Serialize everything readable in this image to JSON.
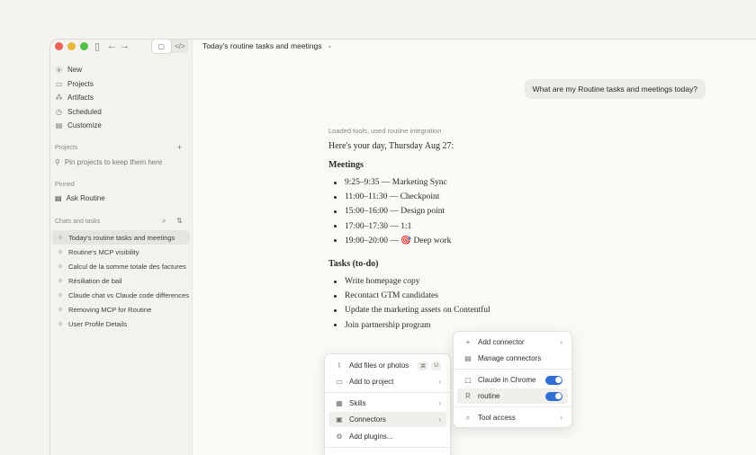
{
  "window": {
    "title": "Today's routine tasks and meetings"
  },
  "sidebar": {
    "nav": [
      {
        "label": "New",
        "icon": "plus-icon"
      },
      {
        "label": "Projects",
        "icon": "folder-icon"
      },
      {
        "label": "Artifacts",
        "icon": "artifacts-icon"
      },
      {
        "label": "Scheduled",
        "icon": "clock-icon"
      },
      {
        "label": "Customize",
        "icon": "briefcase-icon"
      }
    ],
    "projects_label": "Projects",
    "pin_hint": "Pin projects to keep them here",
    "pinned_label": "Pinned",
    "pinned_item": "Ask Routine",
    "chats_label": "Chats and tasks",
    "chats": [
      "Today's routine tasks and meetings",
      "Routine's MCP visibility",
      "Calcul de la somme totale des factures",
      "Résiliation de bail",
      "Claude chat vs Claude code differences",
      "Removing MCP for Routine",
      "User Profile Details"
    ]
  },
  "conversation": {
    "user_message": "What are my Routine tasks and meetings today?",
    "tools_note": "Loaded tools, used routine integration",
    "intro": "Here's your day, Thursday Aug 27:",
    "meetings_heading": "Meetings",
    "meetings": [
      "9:25–9:35 — Marketing Sync",
      "11:00–11:30 — Checkpoint",
      "15:00–16:00 — Design point",
      "17:00–17:30 — 1:1",
      "19:00–20:00 — 🎯 Deep work"
    ],
    "tasks_heading": "Tasks (to-do)",
    "tasks": [
      "Write homepage copy",
      "Recontact GTM candidates",
      "Update the marketing assets on Contentful",
      "Join partnership program"
    ]
  },
  "attach_menu": {
    "items": [
      {
        "label": "Add files or photos",
        "icon": "paperclip-icon",
        "shortcut": [
          "⌘",
          "U"
        ]
      },
      {
        "label": "Add to project",
        "icon": "folder-icon"
      },
      {
        "label": "Skills",
        "icon": "skills-icon"
      },
      {
        "label": "Connectors",
        "icon": "connectors-icon"
      },
      {
        "label": "Add plugins...",
        "icon": "plugin-icon"
      }
    ]
  },
  "connectors_menu": {
    "items": [
      {
        "label": "Add connector",
        "icon": "plus-icon"
      },
      {
        "label": "Manage connectors",
        "icon": "briefcase-icon"
      },
      {
        "label": "Claude in Chrome",
        "icon": "chrome-icon",
        "enabled": true
      },
      {
        "label": "routine",
        "icon": "routine-icon",
        "enabled": true
      },
      {
        "label": "Tool access",
        "icon": "search-icon"
      }
    ]
  },
  "colors": {
    "accent_toggle": "#2f6fd6",
    "traffic_red": "#ec5f57",
    "traffic_yellow": "#e9b83a",
    "traffic_green": "#4fc146"
  }
}
